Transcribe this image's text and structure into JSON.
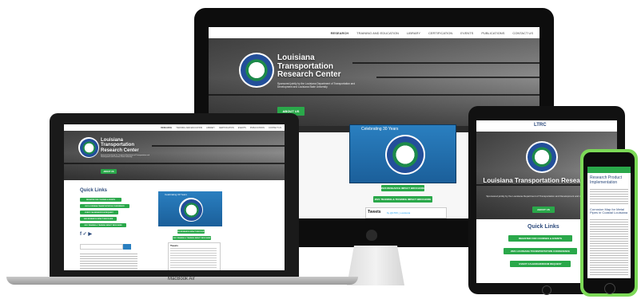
{
  "site": {
    "title_line1": "Louisiana",
    "title_line2": "Transportation",
    "title_line3": "Research Center",
    "title_full": "Louisiana Transportation Research Center",
    "subtitle": "Sponsored jointly by the Louisiana Department of Transportation and Development and Louisiana State University",
    "about_label": "ABOUT US",
    "ltrc_label": "LTRC"
  },
  "nav": {
    "items": [
      "RESEARCH",
      "TRAINING AND EDUCATION",
      "LIBRARY",
      "CERTIFICATION",
      "EVENTS",
      "PUBLICATIONS",
      "CONTACT US"
    ]
  },
  "video": {
    "caption": "Celebrating 30 Years"
  },
  "buttons": {
    "register": "REGISTER FOR COURSES & EVENTS",
    "conference": "2021 LOUISIANA TRANSPORTATION CONFERENCE",
    "calendar": "EVENT CALENDAR/ROOM REQUEST",
    "research_impact": "2020 RESEARCH IMPACT BROCHURE",
    "training_impact": "2021 TRAINING & TRAINING IMPACT BROCHURE"
  },
  "quick_links": {
    "heading": "Quick Links"
  },
  "tweets": {
    "heading": "Tweets",
    "by": "by @LTRC_Louisiana"
  },
  "phone": {
    "heading1": "Research Product",
    "heading2": "Implementation",
    "article1": "Corrosion Map for Metal",
    "article2": "Pipes in Coastal Louisiana"
  },
  "laptop": {
    "brand": "MacBook Air"
  },
  "colors": {
    "accent": "#2aa84a",
    "heading": "#2c4a7c",
    "bezel": "#111111"
  }
}
